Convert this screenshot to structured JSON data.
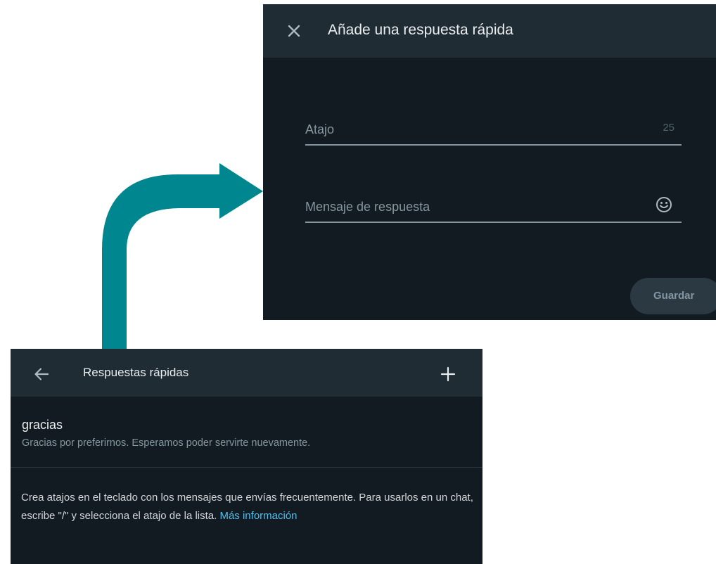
{
  "dialog": {
    "title": "Añade una respuesta rápida",
    "close_icon": "close-icon",
    "shortcut_placeholder": "Atajo",
    "shortcut_counter": "25",
    "message_placeholder": "Mensaje de respuesta",
    "emoji_icon": "smiley-icon",
    "save_label": "Guardar"
  },
  "panel": {
    "title": "Respuestas rápidas",
    "back_icon": "arrow-left-icon",
    "add_icon": "plus-icon",
    "replies": [
      {
        "shortcut": "gracias",
        "message": "Gracias por preferirnos. Esperamos poder servirte nuevamente."
      }
    ],
    "info_text": "Crea atajos en el teclado con los mensajes que envías frecuentemente. Para usarlos en un chat, escribe \"/\" y selecciona el atajo de la lista.",
    "info_link": "Más información"
  },
  "colors": {
    "arrow": "#00868f",
    "panel_bg": "#111b21",
    "header_bg": "#202c33",
    "primary_text": "#e9edef",
    "secondary_text": "#8696a0",
    "link": "#53bdeb"
  }
}
